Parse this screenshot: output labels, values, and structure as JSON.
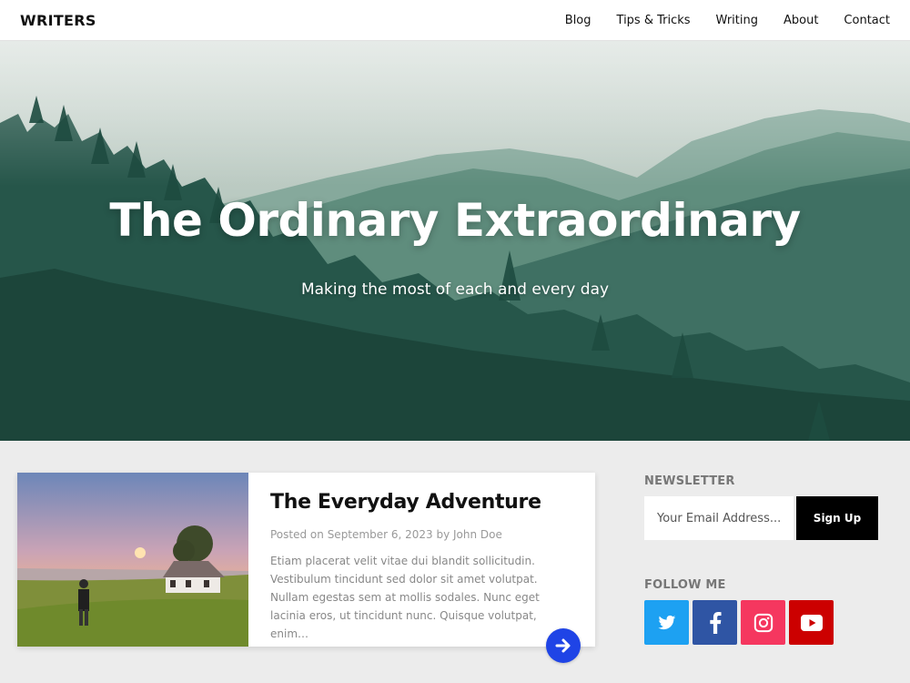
{
  "header": {
    "logo": "WRITERS",
    "nav": [
      {
        "label": "Blog"
      },
      {
        "label": "Tips & Tricks"
      },
      {
        "label": "Writing"
      },
      {
        "label": "About"
      },
      {
        "label": "Contact"
      }
    ]
  },
  "hero": {
    "title": "The Ordinary Extraordinary",
    "subtitle": "Making the most of each and every day"
  },
  "post": {
    "title": "The Everyday Adventure",
    "meta_prefix": "Posted on ",
    "date": "September 6, 2023",
    "meta_by": " by ",
    "author": "John Doe",
    "excerpt": "Etiam placerat velit vitae dui blandit sollicitudin. Vestibulum tincidunt sed dolor sit amet volutpat. Nullam egestas sem at mollis sodales. Nunc eget lacinia eros, ut tincidunt nunc. Quisque volutpat, enim…"
  },
  "newsletter": {
    "title": "NEWSLETTER",
    "placeholder": "Your Email Address...",
    "button_label": "Sign Up"
  },
  "follow": {
    "title": "FOLLOW ME",
    "icons": [
      {
        "name": "twitter-icon",
        "color": "#1da1f2"
      },
      {
        "name": "facebook-icon",
        "color": "#2f55a4"
      },
      {
        "name": "instagram-icon",
        "color": "#f5375f"
      },
      {
        "name": "youtube-icon",
        "color": "#cc0000"
      }
    ]
  },
  "colors": {
    "accent": "#1f44e6",
    "button": "#000000"
  }
}
